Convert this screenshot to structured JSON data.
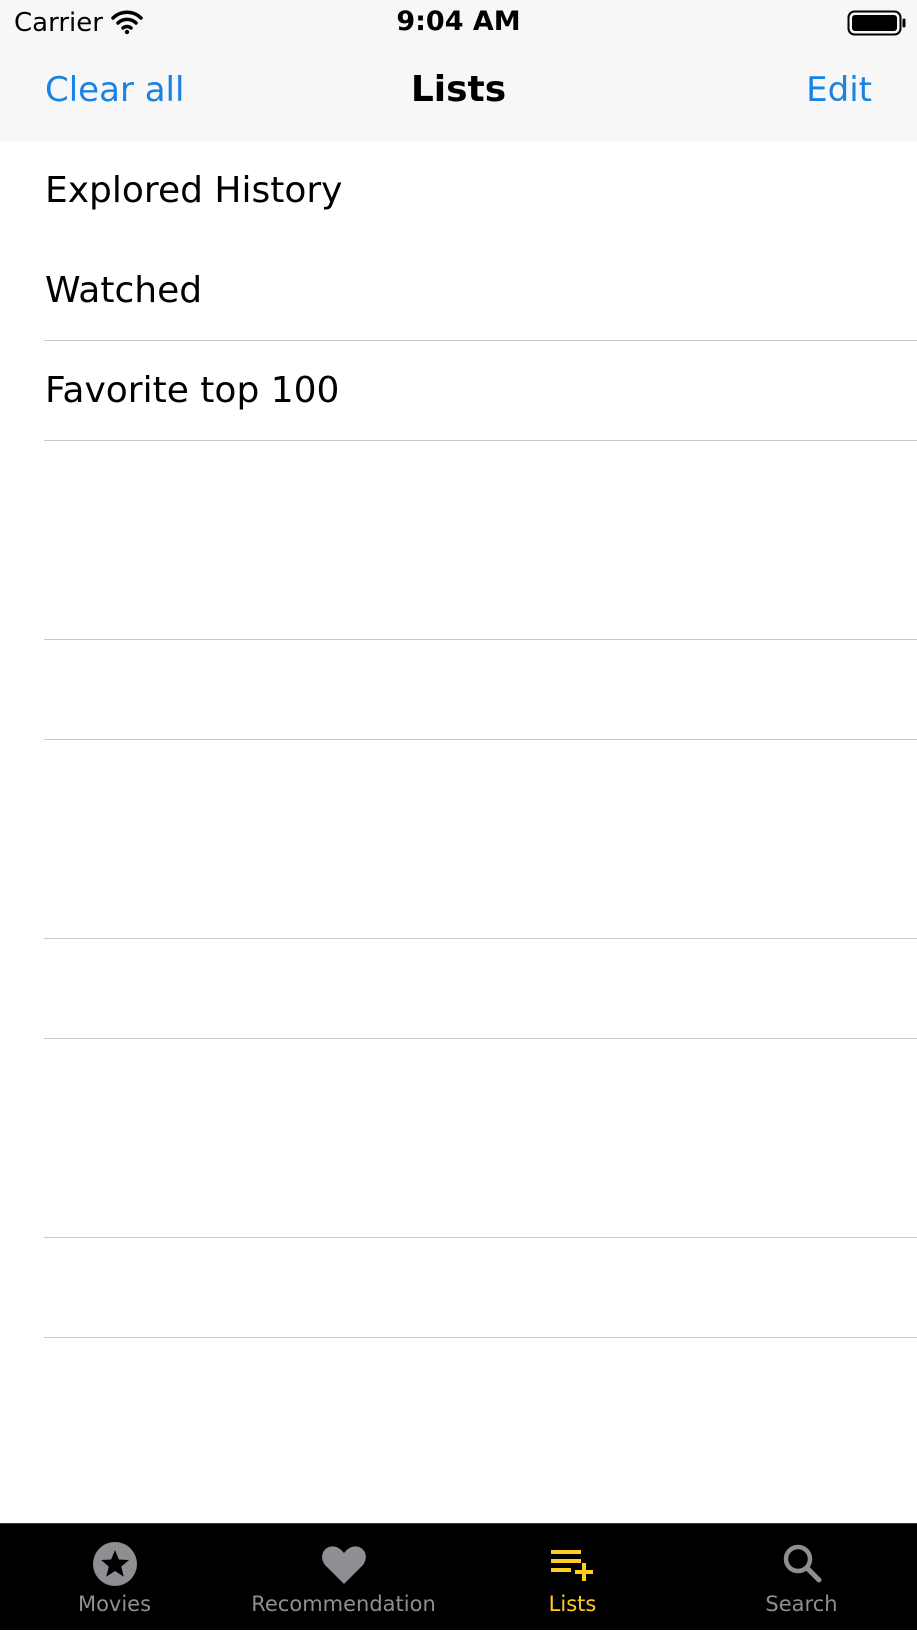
{
  "status_bar": {
    "carrier": "Carrier",
    "time": "9:04 AM"
  },
  "nav": {
    "left_button": "Clear all",
    "title": "Lists",
    "right_button": "Edit"
  },
  "lists": [
    {
      "label": "Explored History"
    },
    {
      "label": "Watched"
    },
    {
      "label": "Favorite top 100"
    }
  ],
  "tabs": [
    {
      "label": "Movies",
      "icon": "star-circle-icon",
      "active": false
    },
    {
      "label": "Recommendation",
      "icon": "heart-icon",
      "active": false
    },
    {
      "label": "Lists",
      "icon": "playlist-add-icon",
      "active": true
    },
    {
      "label": "Search",
      "icon": "magnifier-icon",
      "active": false
    }
  ],
  "colors": {
    "accent": "#1a82e2",
    "active_tab": "#ffcc22",
    "inactive_tab": "#8e8e93",
    "tab_bar_bg": "#000000"
  }
}
